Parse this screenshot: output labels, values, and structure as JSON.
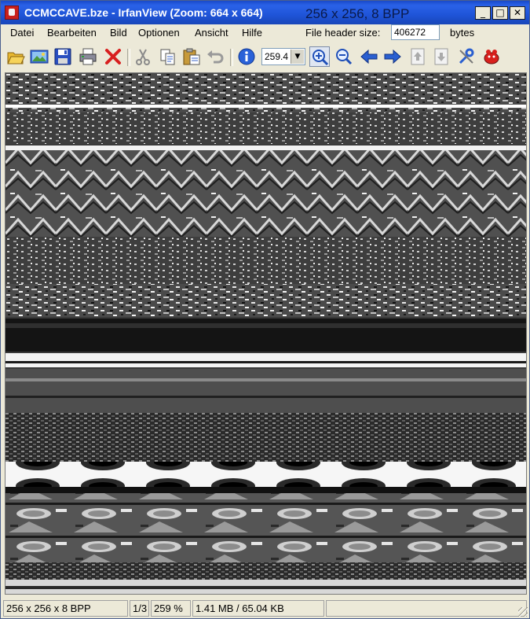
{
  "window": {
    "title": "CCMCCAVE.bze - IrfanView (Zoom: 664 x 664)",
    "image_info": "256 x 256,  8 BPP",
    "minimize_glyph": "_",
    "maximize_glyph": "□",
    "close_glyph": "✕"
  },
  "menu": {
    "items": [
      "Datei",
      "Bearbeiten",
      "Bild",
      "Optionen",
      "Ansicht",
      "Hilfe"
    ],
    "header_label": "File header size:",
    "header_value": "406272",
    "header_unit": "bytes"
  },
  "toolbar": {
    "zoom_value": "259.4",
    "zoom_arrow": "▼",
    "tools": [
      "open-icon",
      "thumbnails-icon",
      "save-icon",
      "print-icon",
      "delete-icon",
      "cut-icon",
      "copy-icon",
      "paste-icon",
      "undo-icon",
      "info-icon",
      "zoom-in-icon",
      "zoom-out-icon",
      "previous-icon",
      "next-icon",
      "page-up-icon",
      "page-down-icon",
      "settings-icon",
      "about-icon"
    ]
  },
  "statusbar": {
    "dimensions": "256 x 256 x 8 BPP",
    "page": "1/3",
    "zoom": "259 %",
    "size": "1.41 MB / 65.04 KB"
  },
  "colors": {
    "titlebar": "#1f54d8",
    "chrome": "#ece9d8",
    "delete_red": "#d81f1f",
    "arrow_blue": "#2a5fd0"
  }
}
